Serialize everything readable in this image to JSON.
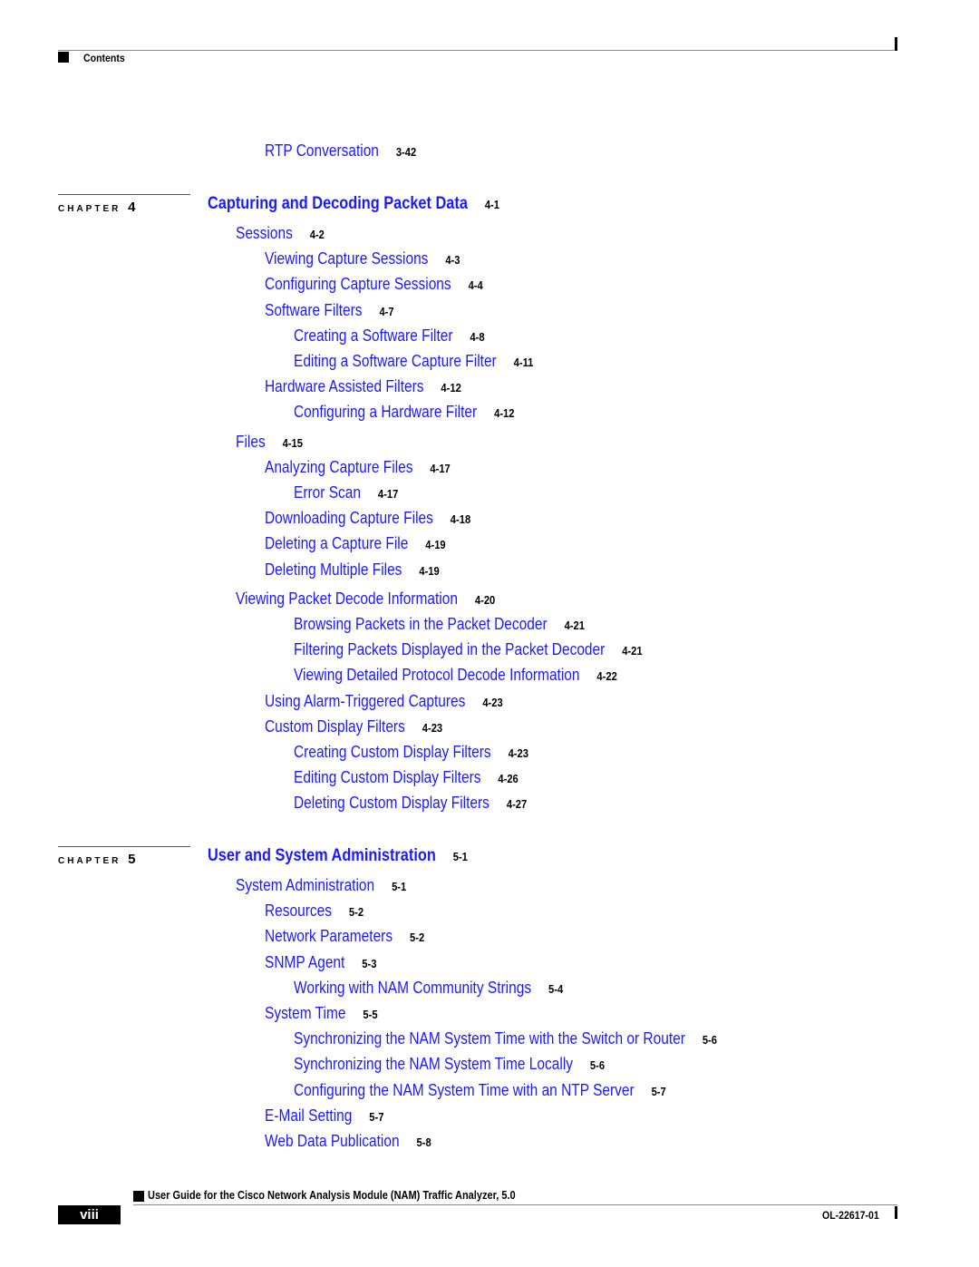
{
  "header": {
    "section_label": "Contents"
  },
  "toc_entries_pre": [
    {
      "title": "RTP Conversation",
      "page": "3-42"
    }
  ],
  "chapters": [
    {
      "label": "CHAPTER",
      "number": "4",
      "title": "Capturing and Decoding Packet Data",
      "page": "4-1",
      "entries": [
        {
          "title": "Sessions",
          "page": "4-2",
          "level": 1
        },
        {
          "title": "Viewing Capture Sessions",
          "page": "4-3",
          "level": 2
        },
        {
          "title": "Configuring Capture Sessions",
          "page": "4-4",
          "level": 2
        },
        {
          "title": "Software Filters",
          "page": "4-7",
          "level": 2
        },
        {
          "title": "Creating a Software Filter",
          "page": "4-8",
          "level": 3
        },
        {
          "title": "Editing a Software Capture Filter",
          "page": "4-11",
          "level": 3
        },
        {
          "title": "Hardware Assisted Filters",
          "page": "4-12",
          "level": 2
        },
        {
          "title": "Configuring a Hardware Filter",
          "page": "4-12",
          "level": 3
        },
        {
          "title": "Files",
          "page": "4-15",
          "level": 1
        },
        {
          "title": "Analyzing Capture Files",
          "page": "4-17",
          "level": 2
        },
        {
          "title": "Error Scan",
          "page": "4-17",
          "level": 3
        },
        {
          "title": "Downloading Capture Files",
          "page": "4-18",
          "level": 2
        },
        {
          "title": "Deleting a Capture File",
          "page": "4-19",
          "level": 2
        },
        {
          "title": "Deleting Multiple Files",
          "page": "4-19",
          "level": 2
        },
        {
          "title": "Viewing Packet Decode Information",
          "page": "4-20",
          "level": 1
        },
        {
          "title": "Browsing Packets in the Packet Decoder",
          "page": "4-21",
          "level": 3
        },
        {
          "title": "Filtering Packets Displayed in the Packet Decoder",
          "page": "4-21",
          "level": 3
        },
        {
          "title": "Viewing Detailed Protocol Decode Information",
          "page": "4-22",
          "level": 3
        },
        {
          "title": "Using Alarm-Triggered Captures",
          "page": "4-23",
          "level": 2
        },
        {
          "title": "Custom Display Filters",
          "page": "4-23",
          "level": 2
        },
        {
          "title": "Creating Custom Display Filters",
          "page": "4-23",
          "level": 3
        },
        {
          "title": "Editing Custom Display Filters",
          "page": "4-26",
          "level": 3
        },
        {
          "title": "Deleting Custom Display Filters",
          "page": "4-27",
          "level": 3
        }
      ]
    },
    {
      "label": "CHAPTER",
      "number": "5",
      "title": "User and System Administration",
      "page": "5-1",
      "entries": [
        {
          "title": "System Administration",
          "page": "5-1",
          "level": 1
        },
        {
          "title": "Resources",
          "page": "5-2",
          "level": 2
        },
        {
          "title": "Network Parameters",
          "page": "5-2",
          "level": 2
        },
        {
          "title": "SNMP Agent",
          "page": "5-3",
          "level": 2
        },
        {
          "title": "Working with NAM Community Strings",
          "page": "5-4",
          "level": 3
        },
        {
          "title": "System Time",
          "page": "5-5",
          "level": 2
        },
        {
          "title": "Synchronizing the NAM System Time with the Switch or Router",
          "page": "5-6",
          "level": 3
        },
        {
          "title": "Synchronizing the NAM System Time Locally",
          "page": "5-6",
          "level": 3
        },
        {
          "title": "Configuring the NAM System Time with an NTP Server",
          "page": "5-7",
          "level": 3
        },
        {
          "title": "E-Mail Setting",
          "page": "5-7",
          "level": 2
        },
        {
          "title": "Web Data Publication",
          "page": "5-8",
          "level": 2
        }
      ]
    }
  ],
  "footer": {
    "guide_title": "User Guide for the Cisco Network Analysis Module (NAM) Traffic Analyzer, 5.0",
    "page_number": "viii",
    "doc_number": "OL-22617-01"
  },
  "colors": {
    "link": "#1a1aff",
    "text": "#000000"
  }
}
